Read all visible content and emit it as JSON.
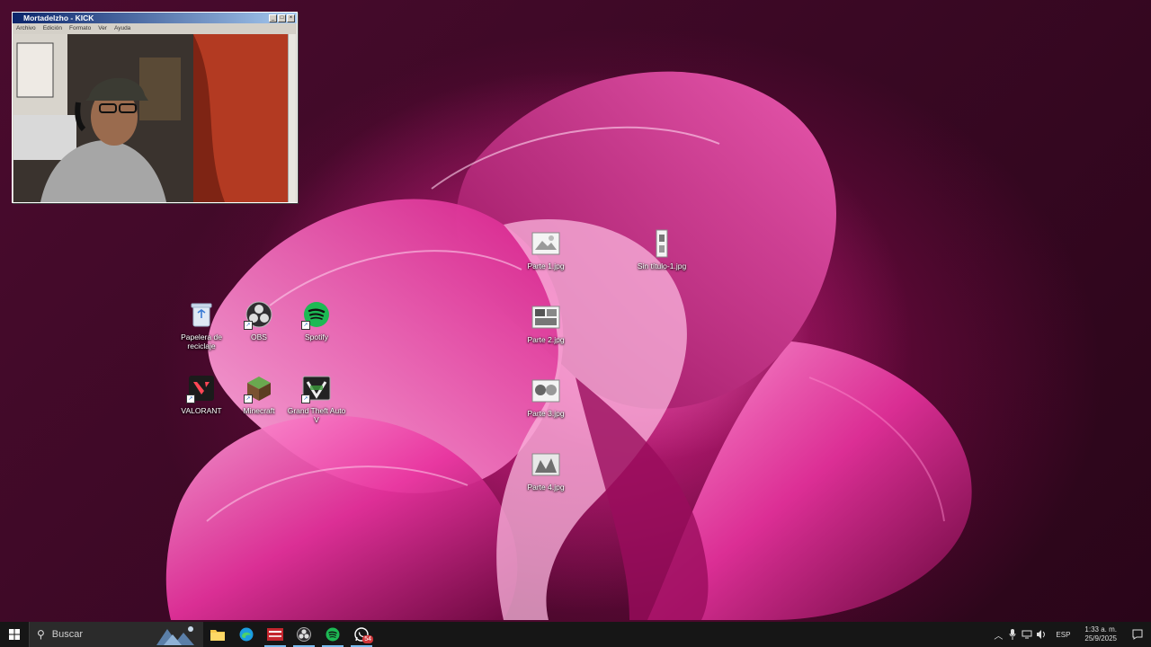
{
  "webcam_window": {
    "title": "Mortadelzho - KICK",
    "menu": [
      "Archivo",
      "Edición",
      "Formato",
      "Ver",
      "Ayuda"
    ]
  },
  "desktop": {
    "icons": [
      {
        "label": "Papelera de reciclaje",
        "icon": "recycle-bin-icon"
      },
      {
        "label": "OBS",
        "icon": "obs-icon"
      },
      {
        "label": "Spotify",
        "icon": "spotify-icon"
      },
      {
        "label": "VALORANT",
        "icon": "valorant-icon"
      },
      {
        "label": "Minecraft",
        "icon": "minecraft-icon"
      },
      {
        "label": "Grand Theft Auto V",
        "icon": "gta-v-icon"
      },
      {
        "label": "Parte 1.jpg",
        "icon": "image-file-icon"
      },
      {
        "label": "Sin título-1.jpg",
        "icon": "image-file-icon"
      },
      {
        "label": "Parte 2.jpg",
        "icon": "image-file-icon"
      },
      {
        "label": "Parte 3.jpg",
        "icon": "image-file-icon"
      },
      {
        "label": "Parte 4.jpg",
        "icon": "image-file-icon"
      }
    ]
  },
  "taskbar": {
    "search_placeholder": "Buscar",
    "whatsapp_badge": "54",
    "language": "ESP",
    "time": "1:33 a. m.",
    "date": "25/9/2025"
  },
  "colors": {
    "wallpaper_accent": "#e62896",
    "taskbar": "#161616",
    "spotify": "#1db954",
    "titlebar": "#0a246a"
  }
}
